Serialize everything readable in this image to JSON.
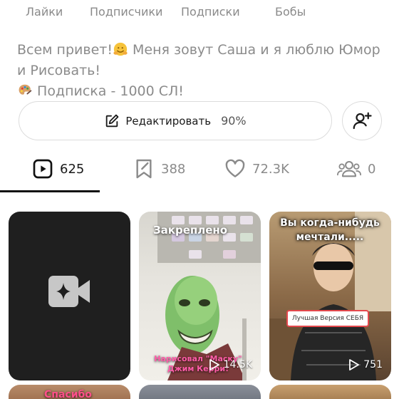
{
  "stats": {
    "likes": "Лайки",
    "followers": "Подписчики",
    "following": "Подписки",
    "bobs": "Бобы"
  },
  "bio": {
    "part1": "Всем привет!",
    "part2": " Меня зовут Саша и я люблю Юмор и Рисовать!",
    "part3": " Подписка - 1000 СЛ!"
  },
  "profile_actions": {
    "edit_label": "Редактировать",
    "edit_progress": "90%"
  },
  "tabs": [
    {
      "icon": "play-square-icon",
      "count": "625"
    },
    {
      "icon": "bookmark-icon",
      "count": "388"
    },
    {
      "icon": "heart-icon",
      "count": "72.3K"
    },
    {
      "icon": "friends-icon",
      "count": "0"
    }
  ],
  "grid": {
    "tile2": {
      "pinned": "Закреплено",
      "caption": "Нарисовал \"Маску\" Джим Керри!",
      "views": "14.5K"
    },
    "tile3": {
      "title": "Вы когда-нибудь мечтали.....",
      "badge": "Лучшая Версия СЕБЯ",
      "views": "751"
    },
    "row2_tile1": {
      "caption": "Спасибо"
    }
  },
  "colors": {
    "text_muted": "#8b8b8b",
    "border": "#dcdcdc",
    "accent_dark": "#111111",
    "badge_red": "#e5484d"
  }
}
